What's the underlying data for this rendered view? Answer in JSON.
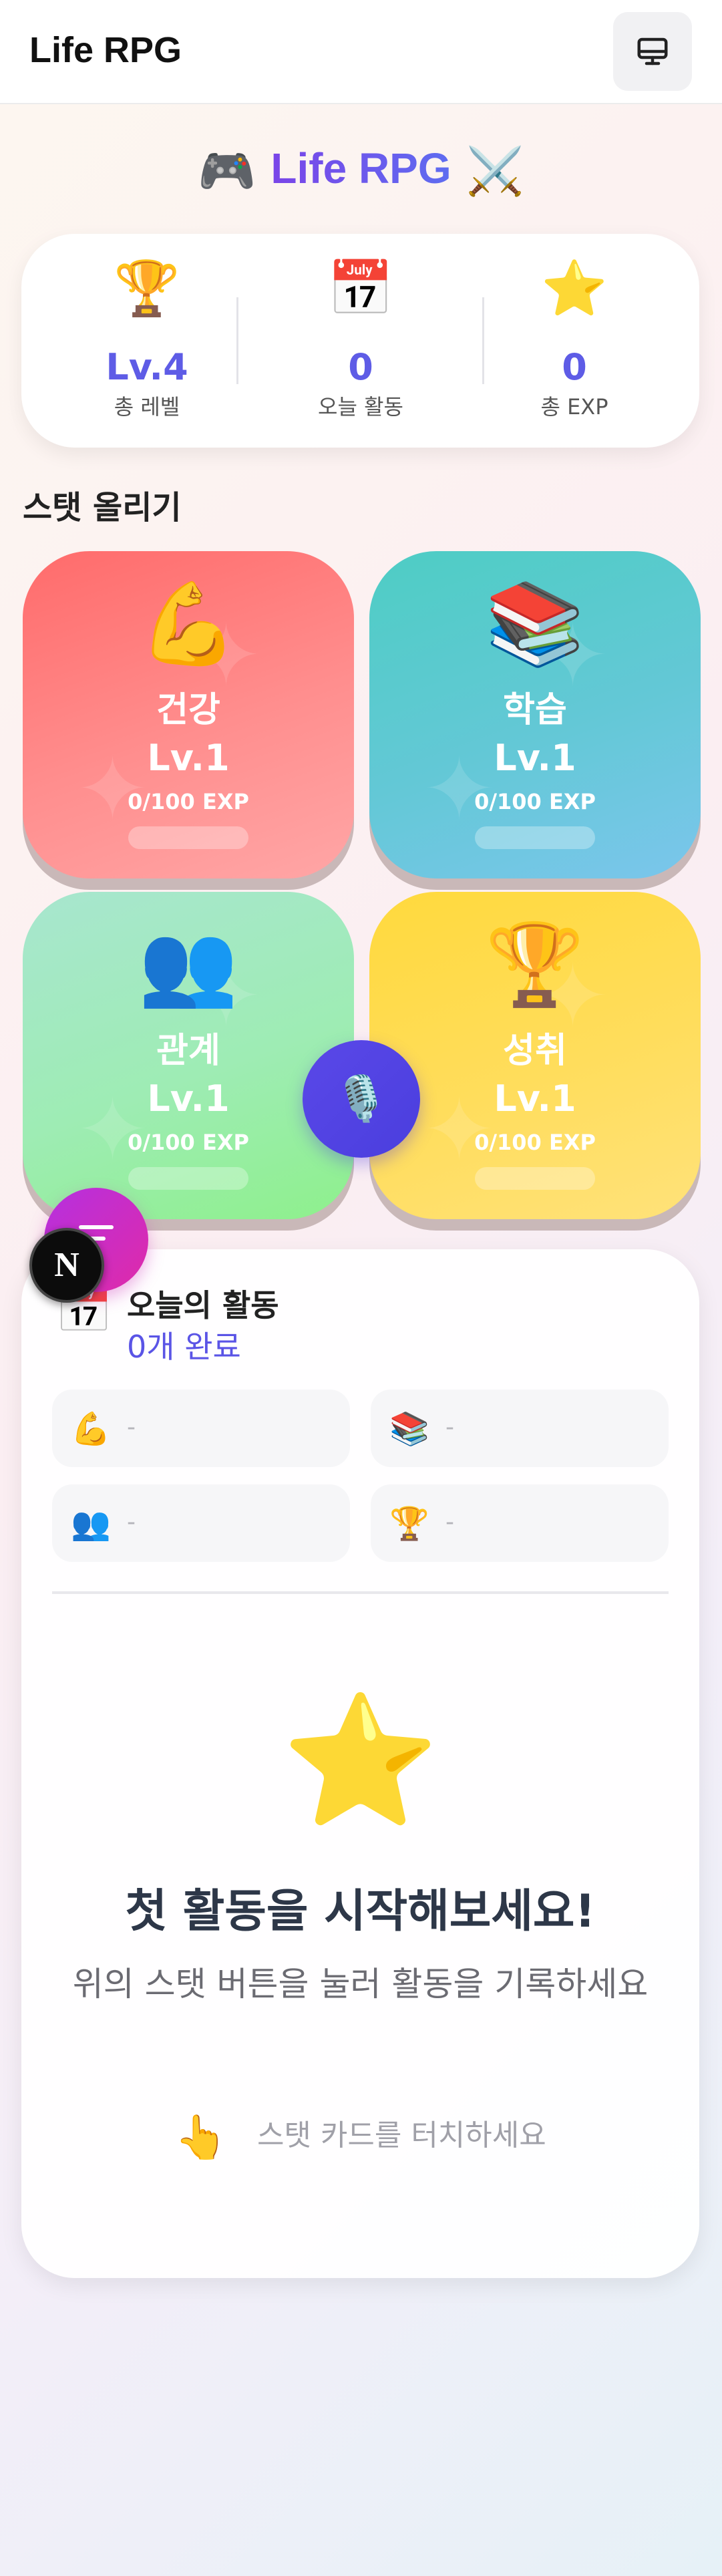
{
  "header": {
    "title": "Life RPG",
    "action_icon": "monitor-icon"
  },
  "hero": {
    "left_emoji": "🎮",
    "title": "Life RPG",
    "right_emoji": "⚔️"
  },
  "summary": {
    "level": {
      "icon": "🏆",
      "value": "Lv.4",
      "label": "총 레벨"
    },
    "today": {
      "icon": "📅",
      "value": "0",
      "label": "오늘 활동"
    },
    "exp": {
      "icon": "⭐",
      "value": "0",
      "label": "총 EXP"
    }
  },
  "stats_section": {
    "title": "스탯 올리기"
  },
  "stats": [
    {
      "icon": "💪",
      "name": "건강",
      "level": "Lv.1",
      "exp": "0/100 EXP",
      "progress": 0,
      "color": "#ff6b6b"
    },
    {
      "icon": "📚",
      "name": "학습",
      "level": "Lv.1",
      "exp": "0/100 EXP",
      "progress": 0,
      "color": "#4ecdc4"
    },
    {
      "icon": "👥",
      "name": "관계",
      "level": "Lv.1",
      "exp": "0/100 EXP",
      "progress": 0,
      "color": "#a8e6cf"
    },
    {
      "icon": "🏆",
      "name": "성취",
      "level": "Lv.1",
      "exp": "0/100 EXP",
      "progress": 0,
      "color": "#ffd93d"
    }
  ],
  "mic_button": {
    "icon": "🎙️"
  },
  "activity": {
    "icon": "📅",
    "title": "오늘의 활동",
    "count": "0개 완료",
    "items": [
      {
        "icon": "💪",
        "text": "-"
      },
      {
        "icon": "📚",
        "text": "-"
      },
      {
        "icon": "👥",
        "text": "-"
      },
      {
        "icon": "🏆",
        "text": "-"
      }
    ],
    "empty": {
      "icon": "⭐",
      "title": "첫 활동을 시작해보세요!",
      "description": "위의 스탯 버튼을 눌러 활동을 기록하세요",
      "hint_icon": "👆",
      "hint": "스탯 카드를 터치하세요"
    }
  },
  "overlay": {
    "next_badge": "N"
  },
  "colors": {
    "accent": "#5e5ce6",
    "menu_fab": "#c42ed0",
    "mic_fab": "#5046e5"
  }
}
